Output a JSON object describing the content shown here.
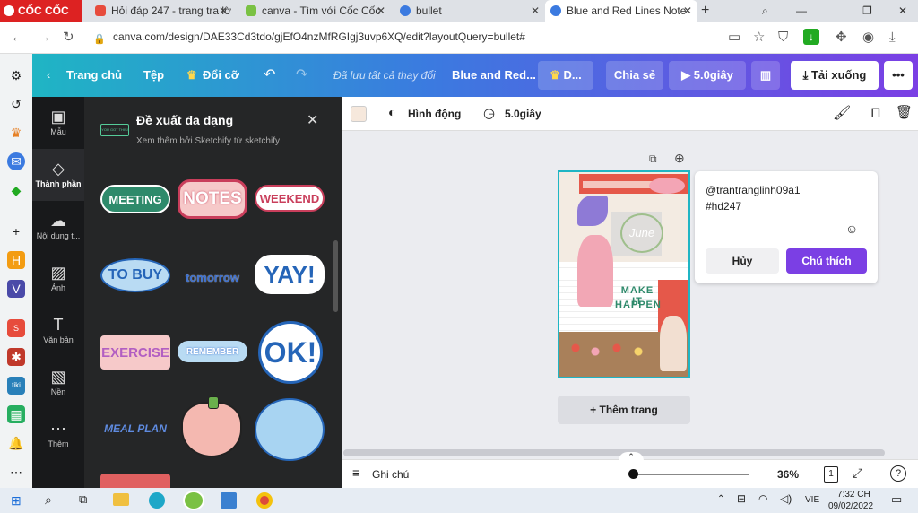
{
  "browser": {
    "logo": "CỐC CỐC",
    "tabs": [
      {
        "label": "Hỏi đáp 247 - trang tra lờ",
        "color": "#e74c3c"
      },
      {
        "label": "canva - Tìm với Cốc Cốc",
        "color": "#7ac143"
      },
      {
        "label": "bullet",
        "color": "#3b7ae0"
      },
      {
        "label": "Blue and Red Lines Note",
        "color": "#3b7ae0"
      }
    ],
    "url": "canva.com/design/DAE33Cd3tdo/gjEfO4nzMfRGIgj3uvp6XQ/edit?layoutQuery=bullet#"
  },
  "topbar": {
    "home": "Trang chủ",
    "file": "Tệp",
    "resize": "Đổi cỡ",
    "saved": "Đã lưu tất cả thay đổi",
    "title": "Blue and Red...",
    "d": "D...",
    "share": "Chia sẻ",
    "play": "5.0giây",
    "download": "Tải xuống"
  },
  "leftnav": [
    {
      "label": "Mẫu",
      "icon": "template-icon"
    },
    {
      "label": "Thành phần",
      "icon": "elements-icon"
    },
    {
      "label": "Nội dung t...",
      "icon": "upload-icon"
    },
    {
      "label": "Ảnh",
      "icon": "photo-icon"
    },
    {
      "label": "Văn bản",
      "icon": "text-icon"
    },
    {
      "label": "Nền",
      "icon": "background-icon"
    },
    {
      "label": "Thêm",
      "icon": "more-icon"
    }
  ],
  "panel": {
    "badge": "YOU GOT THIS!",
    "title": "Đề xuất đa dạng",
    "subtitle": "Xem thêm bởi Sketchify từ sketchify",
    "stickers": [
      "MEETING",
      "NOTES",
      "WEEKEND",
      "TO BUY",
      "tomorrow",
      "YAY!",
      "EXERCISE",
      "REMEMBER",
      "OK!",
      "MEAL PLAN"
    ]
  },
  "canvas_toolbar": {
    "animation": "Hình động",
    "duration": "5.0giây"
  },
  "design": {
    "june": "June",
    "make": "MAKE IT",
    "happen": "HAPPEN"
  },
  "comment": {
    "line1": "@trantranglinh09a1",
    "line2": "#hd247",
    "cancel": "Hủy",
    "submit": "Chú thích"
  },
  "add_page": "+ Thêm trang",
  "bottom": {
    "notes": "Ghi chú",
    "zoom": "36%",
    "page": "1"
  },
  "taskbar": {
    "lang": "VIE",
    "time": "7:32 CH",
    "date": "09/02/2022"
  },
  "colors": {
    "teal": "#1fb5c4",
    "purple": "#7b3fe4",
    "red": "#d22"
  }
}
